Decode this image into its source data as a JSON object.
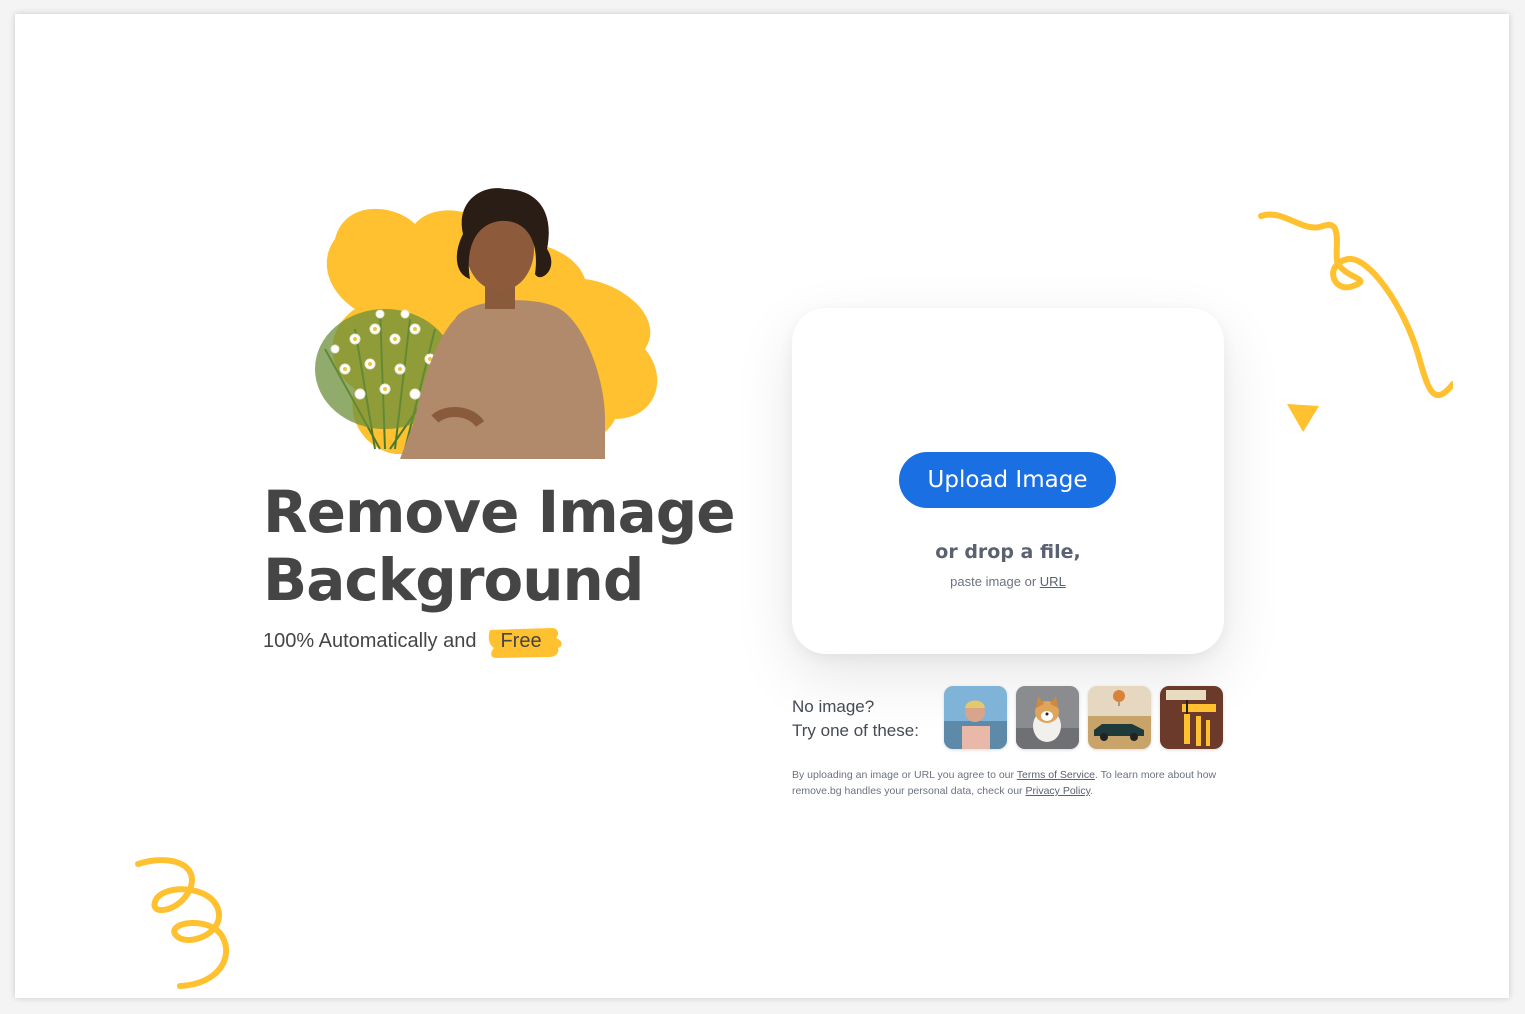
{
  "hero": {
    "title_line1": "Remove Image",
    "title_line2": "Background",
    "subtitle": "100% Automatically and",
    "free_badge": "Free"
  },
  "upload": {
    "button_label": "Upload Image",
    "drop_text": "or drop a file,",
    "paste_prefix": "paste image or",
    "url_link": "URL"
  },
  "samples": {
    "label_line1": "No image?",
    "label_line2": "Try one of these:",
    "items": [
      "person-sample",
      "dog-sample",
      "car-sample",
      "paint-roller-sample"
    ]
  },
  "legal": {
    "prefix": "By uploading an image or URL you agree to our",
    "terms_link": "Terms of Service",
    "middle": ". To learn more about how remove.bg handles your personal data, check our",
    "privacy_link": "Privacy Policy",
    "suffix": "."
  },
  "colors": {
    "accent": "#1a6fe3",
    "yellow": "#ffc130",
    "text": "#454545"
  }
}
